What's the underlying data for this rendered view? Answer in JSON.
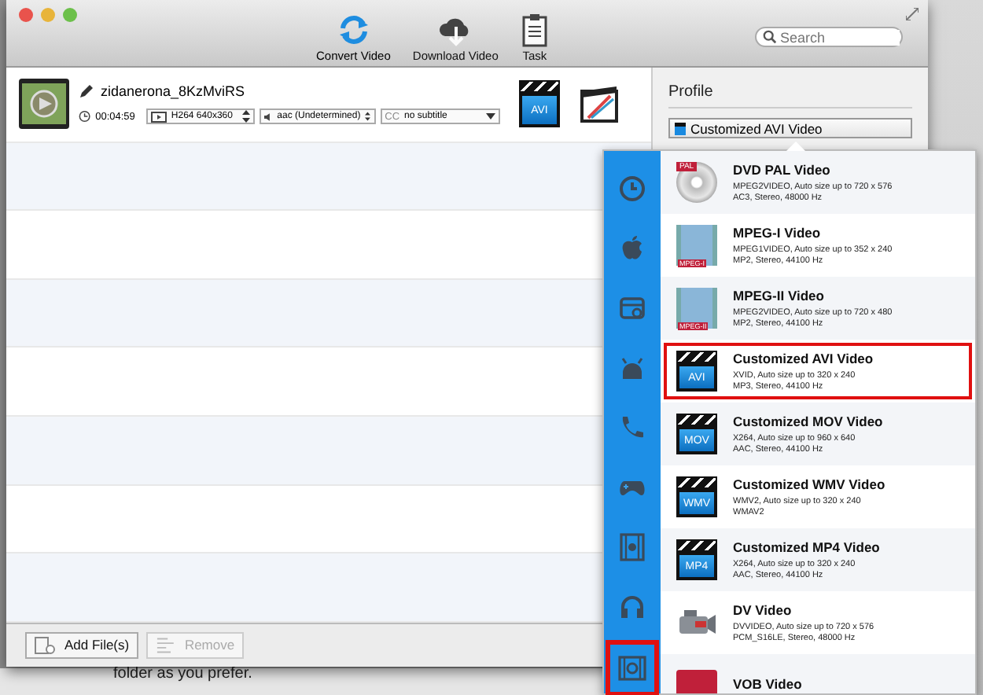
{
  "toolbar": {
    "buttons": [
      {
        "label": "Convert Video",
        "kind": "convert",
        "selected": true
      },
      {
        "label": "Download Video",
        "kind": "download",
        "selected": false
      },
      {
        "label": "Task",
        "kind": "task",
        "selected": false
      }
    ],
    "search": {
      "placeholder": "Search"
    }
  },
  "file": {
    "name": "zidanerona_8KzMviRS",
    "duration": "00:04:59",
    "video": "H264 640x360",
    "audio": "aac (Undetermined)",
    "subtitle_icon": "CC",
    "subtitle": "no subtitle",
    "format_badge": "AVI"
  },
  "profile": {
    "heading": "Profile",
    "value": "Customized AVI Video"
  },
  "categories": [
    {
      "kind": "clock",
      "selected": false
    },
    {
      "kind": "apple",
      "selected": false
    },
    {
      "kind": "drive",
      "selected": false
    },
    {
      "kind": "android",
      "selected": false
    },
    {
      "kind": "phone",
      "selected": false
    },
    {
      "kind": "gamepad",
      "selected": false
    },
    {
      "kind": "film",
      "selected": false
    },
    {
      "kind": "headphones",
      "selected": false
    },
    {
      "kind": "film-disc",
      "selected": true
    }
  ],
  "formats": [
    {
      "name": "DVD PAL Video",
      "details": [
        "MPEG2VIDEO, Auto size up to 720 x 576",
        "AC3, Stereo, 48000 Hz"
      ],
      "kind": "disc",
      "badge": "PAL",
      "selected": false
    },
    {
      "name": "MPEG-I Video",
      "details": [
        "MPEG1VIDEO, Auto size up to 352 x 240",
        "MP2, Stereo, 44100 Hz"
      ],
      "kind": "film",
      "badge": "MPEG-I",
      "selected": false
    },
    {
      "name": "MPEG-II Video",
      "details": [
        "MPEG2VIDEO, Auto size up to 720 x 480",
        "MP2, Stereo, 44100 Hz"
      ],
      "kind": "film",
      "badge": "MPEG-II",
      "selected": false
    },
    {
      "name": "Customized AVI Video",
      "details": [
        "XVID, Auto size up to 320 x 240",
        "MP3, Stereo, 44100 Hz"
      ],
      "kind": "clapper",
      "badge": "AVI",
      "selected": true
    },
    {
      "name": "Customized MOV Video",
      "details": [
        "X264, Auto size up to 960 x 640",
        "AAC, Stereo, 44100 Hz"
      ],
      "kind": "clapper",
      "badge": "MOV",
      "selected": false
    },
    {
      "name": "Customized WMV Video",
      "details": [
        "WMV2, Auto size up to 320 x 240",
        "WMAV2"
      ],
      "kind": "clapper",
      "badge": "WMV",
      "selected": false
    },
    {
      "name": "Customized MP4 Video",
      "details": [
        "X264, Auto size up to 320 x 240",
        "AAC, Stereo, 44100 Hz"
      ],
      "kind": "clapper",
      "badge": "MP4",
      "selected": false
    },
    {
      "name": "DV Video",
      "details": [
        "DVVIDEO, Auto size up to 720 x 576",
        "PCM_S16LE, Stereo, 48000 Hz"
      ],
      "kind": "camcorder",
      "selected": false
    },
    {
      "name": "VOB Video",
      "kind": "vob",
      "selected": false
    }
  ],
  "footer": {
    "buttons": [
      {
        "label": "Add File(s)",
        "kind": "add",
        "disabled": false
      },
      {
        "label": "Remove",
        "kind": "remove",
        "disabled": true
      }
    ]
  },
  "background_text": "folder as you prefer."
}
